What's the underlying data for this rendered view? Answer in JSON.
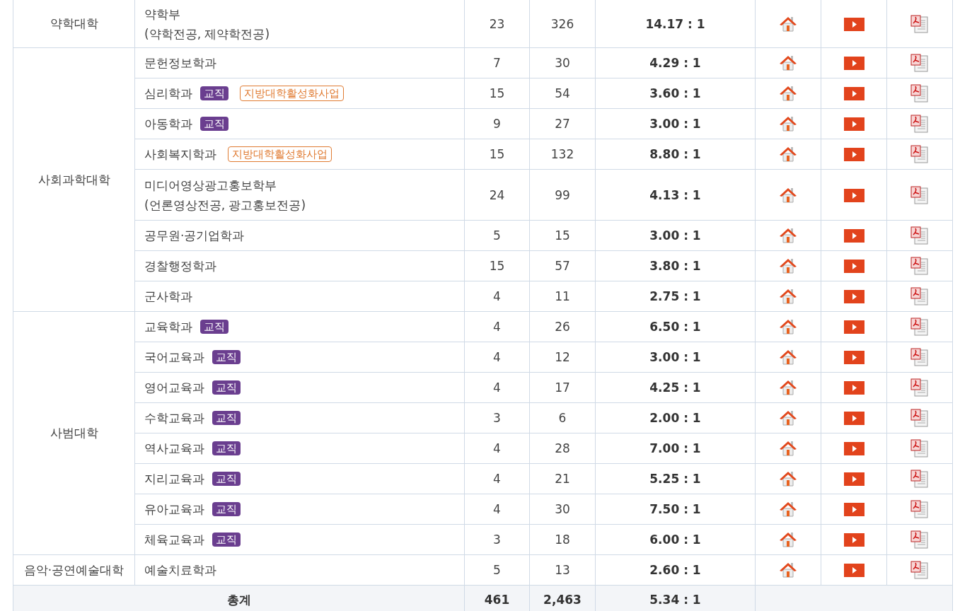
{
  "groups": [
    {
      "college": "약학대학",
      "rows": [
        {
          "name_lines": [
            "약학부",
            "(약학전공, 제약학전공)"
          ],
          "badges": [],
          "quota": "23",
          "applicants": "326",
          "ratio": "14.17 : 1"
        }
      ]
    },
    {
      "college": "사회과학대학",
      "rows": [
        {
          "name_lines": [
            "문헌정보학과"
          ],
          "badges": [],
          "quota": "7",
          "applicants": "30",
          "ratio": "4.29 : 1"
        },
        {
          "name_lines": [
            "심리학과"
          ],
          "badges": [
            {
              "kind": "teaching",
              "text": "교직"
            },
            {
              "kind": "project",
              "text": "지방대학활성화사업"
            }
          ],
          "quota": "15",
          "applicants": "54",
          "ratio": "3.60 : 1"
        },
        {
          "name_lines": [
            "아동학과"
          ],
          "badges": [
            {
              "kind": "teaching",
              "text": "교직"
            }
          ],
          "quota": "9",
          "applicants": "27",
          "ratio": "3.00 : 1"
        },
        {
          "name_lines": [
            "사회복지학과"
          ],
          "badges": [
            {
              "kind": "project",
              "text": "지방대학활성화사업"
            }
          ],
          "quota": "15",
          "applicants": "132",
          "ratio": "8.80 : 1"
        },
        {
          "name_lines": [
            "미디어영상광고홍보학부",
            "(언론영상전공, 광고홍보전공)"
          ],
          "badges": [],
          "quota": "24",
          "applicants": "99",
          "ratio": "4.13 : 1"
        },
        {
          "name_lines": [
            "공무원·공기업학과"
          ],
          "badges": [],
          "quota": "5",
          "applicants": "15",
          "ratio": "3.00 : 1"
        },
        {
          "name_lines": [
            "경찰행정학과"
          ],
          "badges": [],
          "quota": "15",
          "applicants": "57",
          "ratio": "3.80 : 1"
        },
        {
          "name_lines": [
            "군사학과"
          ],
          "badges": [],
          "quota": "4",
          "applicants": "11",
          "ratio": "2.75 : 1"
        }
      ]
    },
    {
      "college": "사범대학",
      "rows": [
        {
          "name_lines": [
            "교육학과"
          ],
          "badges": [
            {
              "kind": "teaching",
              "text": "교직"
            }
          ],
          "quota": "4",
          "applicants": "26",
          "ratio": "6.50 : 1"
        },
        {
          "name_lines": [
            "국어교육과"
          ],
          "badges": [
            {
              "kind": "teaching",
              "text": "교직"
            }
          ],
          "quota": "4",
          "applicants": "12",
          "ratio": "3.00 : 1"
        },
        {
          "name_lines": [
            "영어교육과"
          ],
          "badges": [
            {
              "kind": "teaching",
              "text": "교직"
            }
          ],
          "quota": "4",
          "applicants": "17",
          "ratio": "4.25 : 1"
        },
        {
          "name_lines": [
            "수학교육과"
          ],
          "badges": [
            {
              "kind": "teaching",
              "text": "교직"
            }
          ],
          "quota": "3",
          "applicants": "6",
          "ratio": "2.00 : 1"
        },
        {
          "name_lines": [
            "역사교육과"
          ],
          "badges": [
            {
              "kind": "teaching",
              "text": "교직"
            }
          ],
          "quota": "4",
          "applicants": "28",
          "ratio": "7.00 : 1"
        },
        {
          "name_lines": [
            "지리교육과"
          ],
          "badges": [
            {
              "kind": "teaching",
              "text": "교직"
            }
          ],
          "quota": "4",
          "applicants": "21",
          "ratio": "5.25 : 1"
        },
        {
          "name_lines": [
            "유아교육과"
          ],
          "badges": [
            {
              "kind": "teaching",
              "text": "교직"
            }
          ],
          "quota": "4",
          "applicants": "30",
          "ratio": "7.50 : 1"
        },
        {
          "name_lines": [
            "체육교육과"
          ],
          "badges": [
            {
              "kind": "teaching",
              "text": "교직"
            }
          ],
          "quota": "3",
          "applicants": "18",
          "ratio": "6.00 : 1"
        }
      ]
    },
    {
      "college": "음악·공연예술대학",
      "rows": [
        {
          "name_lines": [
            "예술치료학과"
          ],
          "badges": [],
          "quota": "5",
          "applicants": "13",
          "ratio": "2.60 : 1"
        }
      ]
    }
  ],
  "total": {
    "label": "총계",
    "quota": "461",
    "applicants": "2,463",
    "ratio": "5.34 : 1"
  }
}
